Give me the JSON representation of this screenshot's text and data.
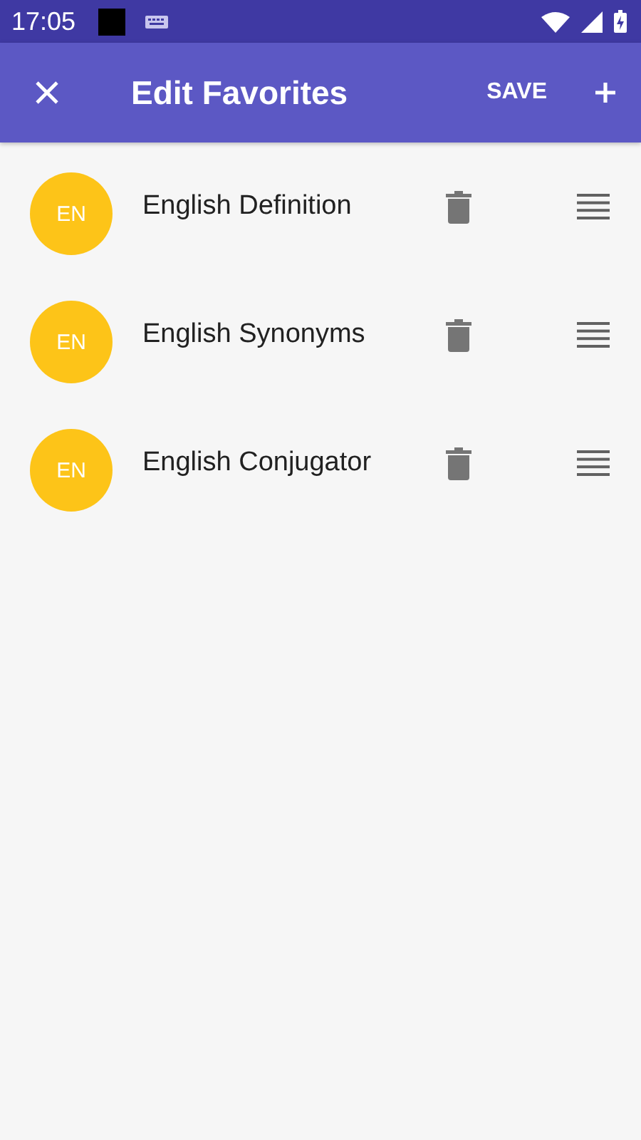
{
  "status_bar": {
    "time": "17:05"
  },
  "app_bar": {
    "title": "Edit Favorites",
    "action": "SAVE"
  },
  "favorites": [
    {
      "badge": "EN",
      "name": "English Definition"
    },
    {
      "badge": "EN",
      "name": "English Synonyms"
    },
    {
      "badge": "EN",
      "name": "English Conjugator"
    }
  ]
}
